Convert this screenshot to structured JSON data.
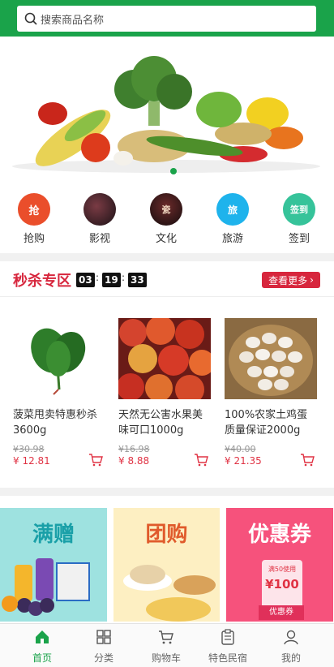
{
  "search": {
    "placeholder": "搜索商品名称"
  },
  "categories": [
    {
      "label": "抢购",
      "icon": "flash-buy-icon",
      "glyph": "抢",
      "color": "#ea4e2b"
    },
    {
      "label": "影视",
      "icon": "film-icon",
      "glyph": "",
      "color": "#3a2b3a"
    },
    {
      "label": "文化",
      "icon": "culture-icon",
      "glyph": "",
      "color": "#2a1f22"
    },
    {
      "label": "旅游",
      "icon": "travel-icon",
      "glyph": "旅",
      "color": "#1eb3ec"
    },
    {
      "label": "签到",
      "icon": "signin-icon",
      "glyph": "签到",
      "color": "#36c39a"
    }
  ],
  "flash_sale": {
    "title": "秒杀专区",
    "timer": {
      "hours": "03",
      "minutes": "19",
      "seconds": "33"
    },
    "more_label": "查看更多"
  },
  "products": [
    {
      "name": "菠菜甩卖特惠秒杀3600g",
      "old_price": "¥30.98",
      "price": "¥ 12.81",
      "image": "spinach"
    },
    {
      "name": "天然无公害水果美味可口1000g",
      "old_price": "¥16.98",
      "price": "¥ 8.88",
      "image": "nectarines"
    },
    {
      "name": "100%农家土鸡蛋质量保证2000g",
      "old_price": "¥40.00",
      "price": "¥ 21.35",
      "image": "eggs"
    }
  ],
  "promos": [
    {
      "title": "满赠",
      "color": "#9ee2e0",
      "text_color": "#1aa0a8"
    },
    {
      "title": "团购",
      "color": "#fdefc2",
      "text_color": "#e05a2b"
    },
    {
      "title": "优惠券",
      "color": "#f6527c",
      "text_color": "#ffffff",
      "tag_1": "满50使用",
      "amount": "¥100",
      "tag_2": "优惠券"
    }
  ],
  "tabs": [
    {
      "label": "首页",
      "icon": "home-icon",
      "active": true
    },
    {
      "label": "分类",
      "icon": "grid-icon",
      "active": false
    },
    {
      "label": "购物车",
      "icon": "cart-icon",
      "active": false
    },
    {
      "label": "特色民宿",
      "icon": "clipboard-icon",
      "active": false
    },
    {
      "label": "我的",
      "icon": "user-icon",
      "active": false
    }
  ],
  "colors": {
    "brand": "#1aa34a",
    "accent": "#d7263d",
    "price": "#e03344"
  }
}
